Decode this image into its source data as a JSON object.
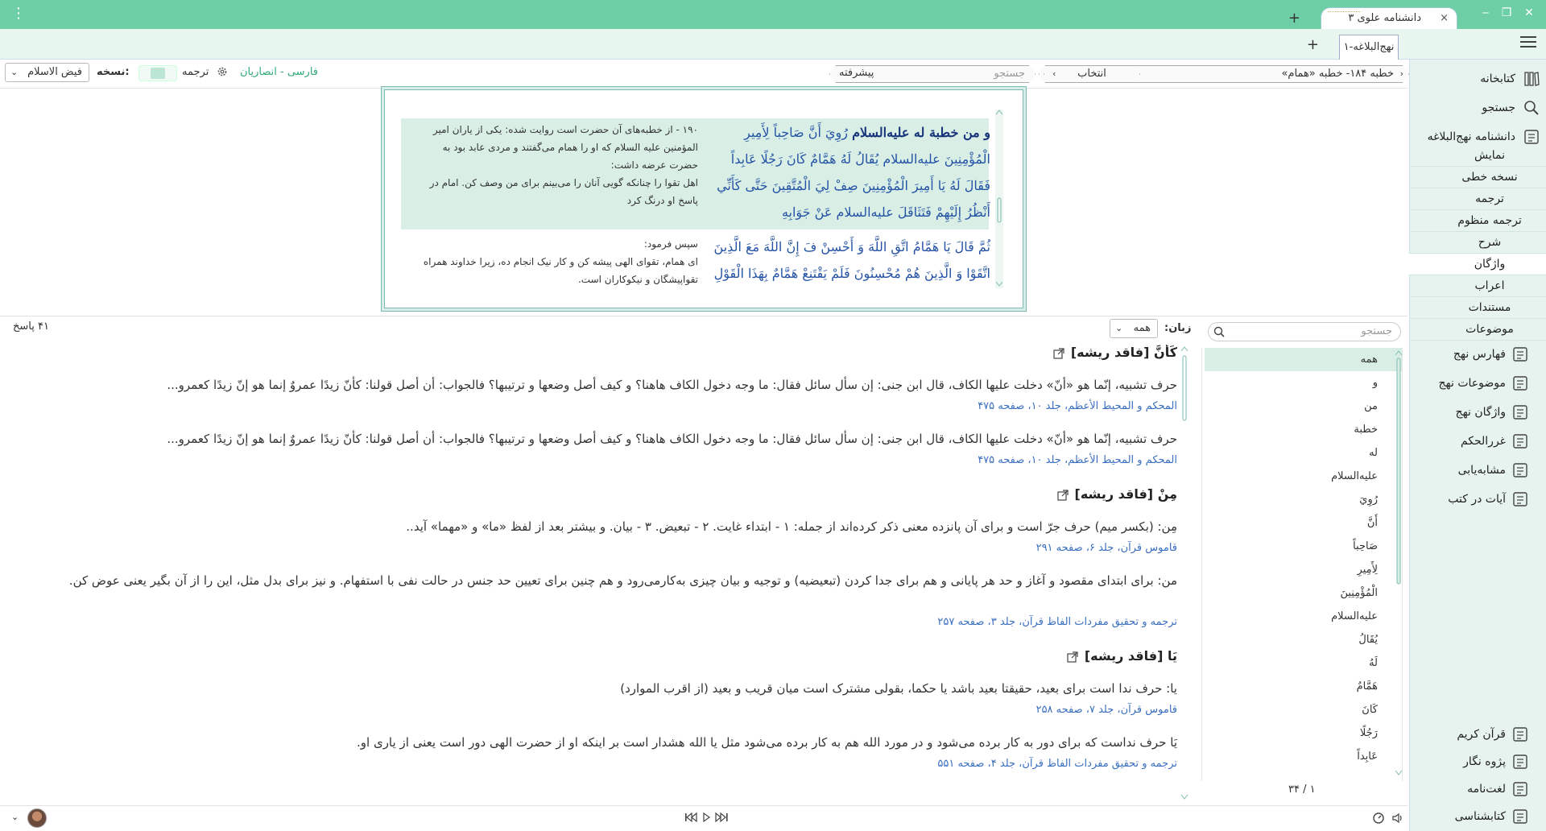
{
  "app": {
    "title": "دانشنامه علوی ۳",
    "close_tab": "×",
    "new_tab": "+",
    "window": {
      "minimize": "‒",
      "restore": "❐",
      "close": "✕"
    },
    "menu": "⋮"
  },
  "doc_tab": {
    "label": "نهج‌البلاغه-۱",
    "add": "+"
  },
  "nav": {
    "breadcrumb": "خطبه ۱۸۴- خطبه «همام»",
    "select_label": "انتخاب",
    "search_placeholder": "جستجو",
    "advanced": "پیشرفته",
    "translation_lang": "فارسی - انصاریان",
    "translation_label": "ترجمه",
    "version_label": "نسخه:",
    "version_value": "فیض الاسلام"
  },
  "sidebar": {
    "top_items": [
      {
        "label": "کتابخانه",
        "icon": "library-icon"
      },
      {
        "label": "جستجو",
        "icon": "search-icon"
      },
      {
        "label": "دانشنامه نهج‌البلاغه",
        "icon": "encyclopedia-icon"
      }
    ],
    "sub_items": [
      {
        "label": "نمایش",
        "active": false
      },
      {
        "label": "نسخه خطی",
        "active": false
      },
      {
        "label": "ترجمه",
        "active": false
      },
      {
        "label": "ترجمه منظوم",
        "active": false
      },
      {
        "label": "شرح",
        "active": false
      },
      {
        "label": "واژگان",
        "active": true
      },
      {
        "label": "اعراب",
        "active": false
      },
      {
        "label": "مستندات",
        "active": false
      },
      {
        "label": "موضوعات",
        "active": false
      }
    ],
    "tool_items": [
      {
        "label": "فهارس نهج",
        "icon": "index-icon"
      },
      {
        "label": "موضوعات نهج",
        "icon": "topics-icon"
      },
      {
        "label": "واژگان نهج",
        "icon": "words-icon"
      },
      {
        "label": "غررالحکم",
        "icon": "ghurar-icon"
      },
      {
        "label": "مشابه‌یابی",
        "icon": "similar-icon"
      },
      {
        "label": "آیات در کتب",
        "icon": "verses-icon"
      }
    ],
    "bottom_items": [
      {
        "label": "قرآن کریم",
        "icon": "quran-icon"
      },
      {
        "label": "پژوه نگار",
        "icon": "notes-icon"
      },
      {
        "label": "لغت‌نامه",
        "icon": "dictionary-icon"
      },
      {
        "label": "کتابشناسی",
        "icon": "bibliography-icon"
      }
    ]
  },
  "text_panel": {
    "ar1_lead": "و من خطبة له علیه‌السلام",
    "ar1": "رُوِيَ أَنَّ صَاحِباً لِأَمِيرِ الْمُؤْمِنِينَ علیه‌السلام يُقَالُ لَهُ هَمَّامٌ كَانَ رَجُلًا عَابِداً فَقَالَ لَهُ يَا أَمِيرَ الْمُؤْمِنِينَ صِفْ لِيَ الْمُتَّقِينَ حَتَّى كَأَنِّي أَنْظُرُ إِلَيْهِمْ فَتَثَاقَلَ علیه‌السلام عَنْ جَوَابِهِ",
    "fa1a": "۱۹۰ - از خطبه‌های آن حضرت است روایت شده: یکی از یاران امیر المؤمنین علیه السلام که او را همام می‌گفتند و مردی عابد بود به حضرت عرضه داشت:",
    "fa1b": "اهل تقوا را چنانکه گویی آنان را می‌بینم برای من وصف کن. امام در پاسخ او درنگ کرد",
    "ar2": "ثُمَّ قَالَ يَا هَمَّامُ اتَّقِ اللَّهَ وَ أَحْسِنْ فَ إِنَّ اللَّهَ مَعَ الَّذِينَ اتَّقَوْا وَ الَّذِينَ هُمْ مُحْسِنُونَ فَلَمْ يَقْتَنِعْ هَمَّامٌ بِهَذَا الْقَوْلِ",
    "fa2a": "سپس فرمود:",
    "fa2b": "ای همام، تقوای الهی پیشه کن و کار نیک انجام ده، زیرا خداوند همراه تقواپیشگان و نیکوکاران است."
  },
  "words": {
    "search_placeholder": "جستجو",
    "items": [
      "همه",
      "و",
      "من",
      "خطبة",
      "له",
      "علیه‌السلام",
      "رُوِيَ",
      "أَنَّ",
      "صَاحِباً",
      "لِأَمِيرِ",
      "الْمُؤْمِنِينَ",
      "علیه‌السلام",
      "يُقَالُ",
      "لَهُ",
      "هَمَّامٌ",
      "كَانَ",
      "رَجُلًا",
      "عَابِداً"
    ],
    "pager": "۱ / ۳۴"
  },
  "results": {
    "lang_label": "زبان:",
    "lang_value": "همه",
    "count": "۴۱ پاسخ",
    "entries": [
      {
        "head": "كَأَنَّ [فاقد ریشه]",
        "rows": [
          {
            "body": "حرف تشبیه، إنّما هو «أنّ» دخلت علیها الکاف، قال ابن جنی: إن سأل سائل فقال: ما وجه دخول الکاف هاهنا؟ و کیف أصل وضعها و ترتیبها؟ فالجواب: أن أصل قولنا: كأنّ زیدًا عمروٌ إنما هو إنّ زیدًا كعمرو...",
            "src": "المحکم و المحیط الأعظم، جلد ۱۰، صفحه ۴۷۵"
          },
          {
            "body": "حرف تشبیه، إنّما هو «أنّ» دخلت علیها الکاف، قال ابن جنی: إن سأل سائل فقال: ما وجه دخول الکاف هاهنا؟ و کیف أصل وضعها و ترتیبها؟ فالجواب: أن أصل قولنا: كأنّ زیدًا عمروٌ إنما هو إنّ زیدًا كعمرو...",
            "src": "المحکم و المحیط الأعظم، جلد ۱۰، صفحه ۴۷۵"
          }
        ]
      },
      {
        "head": "مِنْ [فاقد ریشه]",
        "rows": [
          {
            "body": "مِن: (بکسر میم) حرف جرّ است و برای آن پانزده معنی ذکر کرده‌اند از جمله: ۱ - ابتداء غایت. ۲ - تبعیض. ۳ - بیان. و بیشتر بعد از لفظ «ما» و «مهما» آید..",
            "src": "قاموس قرآن، جلد ۶، صفحه ۲۹۱"
          },
          {
            "body": "من: برای ابتدای مقصود و آغاز و حد هر پایانی و هم برای جدا کردن (تبعیضیه) و توجیه و بیان چیزی به‌کارمی‌رود و هم چنین برای تعیین حد جنس در حالت نفی با استفهام. و نیز برای بدل مثل، این را از آن بگیر یعنی عوض کن.",
            "src": "ترجمه و تحقیق مفردات الفاظ قرآن، جلد ۳، صفحه ۲۵۷"
          }
        ]
      },
      {
        "head": "يَا [فاقد ریشه]",
        "rows": [
          {
            "body": "یا: حرف ندا است برای بعید، حقیقتا بعید باشد یا حکما، بقولی مشترک است میان قریب و بعید (از اقرب الموارد)",
            "src": "قاموس قرآن، جلد ۷، صفحه ۲۵۸"
          },
          {
            "body": "یَا حرف نداست که برای دور به کار برده می‌شود و در مورد الله هم به کار برده می‌شود مثل یا الله هشدار است بر اینکه او از حضرت الهی دور است یعنی از یاری او.",
            "src": "ترجمه و تحقیق مفردات الفاظ قرآن، جلد ۴، صفحه ۵۵۱"
          }
        ]
      }
    ]
  },
  "colors": {
    "accent": "#6ecfa7",
    "link": "#3a6fc0",
    "arabic": "#2553a5",
    "highlight": "#d9efe6"
  }
}
